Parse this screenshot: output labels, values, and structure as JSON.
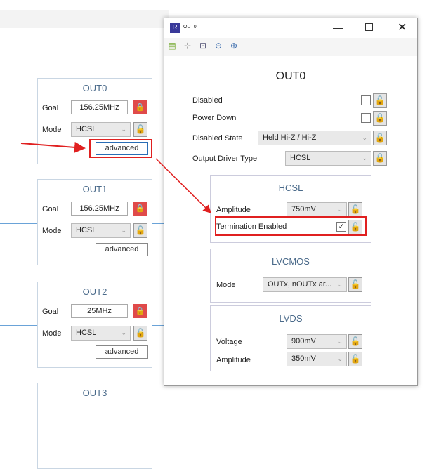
{
  "blocks": [
    {
      "title": "OUT0",
      "goal_label": "Goal",
      "goal": "156.25MHz",
      "mode_label": "Mode",
      "mode": "HCSL",
      "advanced": "advanced"
    },
    {
      "title": "OUT1",
      "goal_label": "Goal",
      "goal": "156.25MHz",
      "mode_label": "Mode",
      "mode": "HCSL",
      "advanced": "advanced"
    },
    {
      "title": "OUT2",
      "goal_label": "Goal",
      "goal": "25MHz",
      "mode_label": "Mode",
      "mode": "HCSL",
      "advanced": "advanced"
    },
    {
      "title": "OUT3"
    }
  ],
  "dialog": {
    "app_icon": "R",
    "title": "OUT0",
    "heading": "OUT0",
    "disabled": "Disabled",
    "power_down": "Power Down",
    "disabled_state_label": "Disabled State",
    "disabled_state": "Held Hi-Z / Hi-Z",
    "driver_label": "Output Driver Type",
    "driver": "HCSL",
    "hcsl": {
      "title": "HCSL",
      "amplitude_label": "Amplitude",
      "amplitude": "750mV",
      "termination_label": "Termination Enabled",
      "termination_checked": true
    },
    "lvcmos": {
      "title": "LVCMOS",
      "mode_label": "Mode",
      "mode": "OUTx, nOUTx ar..."
    },
    "lvds": {
      "title": "LVDS",
      "voltage_label": "Voltage",
      "voltage": "900mV",
      "amplitude_label": "Amplitude",
      "amplitude": "350mV"
    }
  },
  "colors": {
    "annotation": "#e02020",
    "accent": "#4a6a8a",
    "lock_red": "#e04a4a"
  }
}
